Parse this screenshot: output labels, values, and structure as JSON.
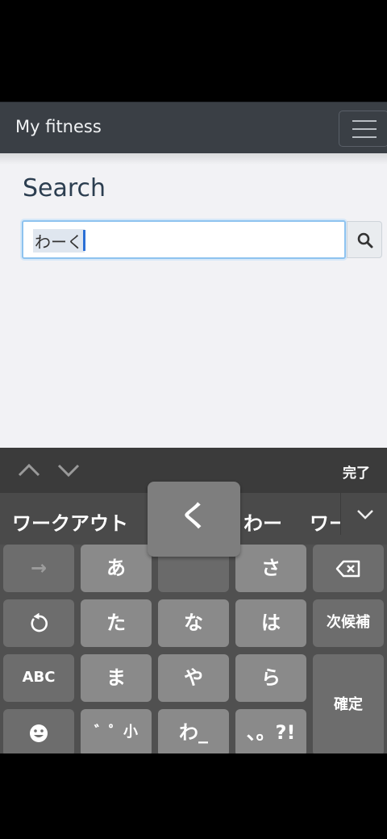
{
  "navbar": {
    "brand": "My fitness",
    "menu_icon": "hamburger-icon"
  },
  "main": {
    "title": "Search",
    "search_value": "わーく",
    "search_icon": "search-icon"
  },
  "keyboard": {
    "toolbar": {
      "up_icon": "chevron-up-icon",
      "down_icon": "chevron-down-icon",
      "done_label": "完了"
    },
    "candidates": [
      "ワークアウト",
      "わー",
      "ワー"
    ],
    "popup_char": "く",
    "keys": {
      "arrow": "→",
      "a": "あ",
      "ka": "",
      "sa": "さ",
      "backspace_icon": "backspace-icon",
      "undo_icon": "undo-icon",
      "ta": "た",
      "na": "な",
      "ha": "は",
      "next_candidate": "次候補",
      "abc": "ABC",
      "ma": "ま",
      "ya": "や",
      "ra": "ら",
      "confirm": "確定",
      "emoji_icon": "emoji-icon",
      "dakuten": "゛゜小",
      "wa": "わ_",
      "punct": "、。?!"
    }
  }
}
